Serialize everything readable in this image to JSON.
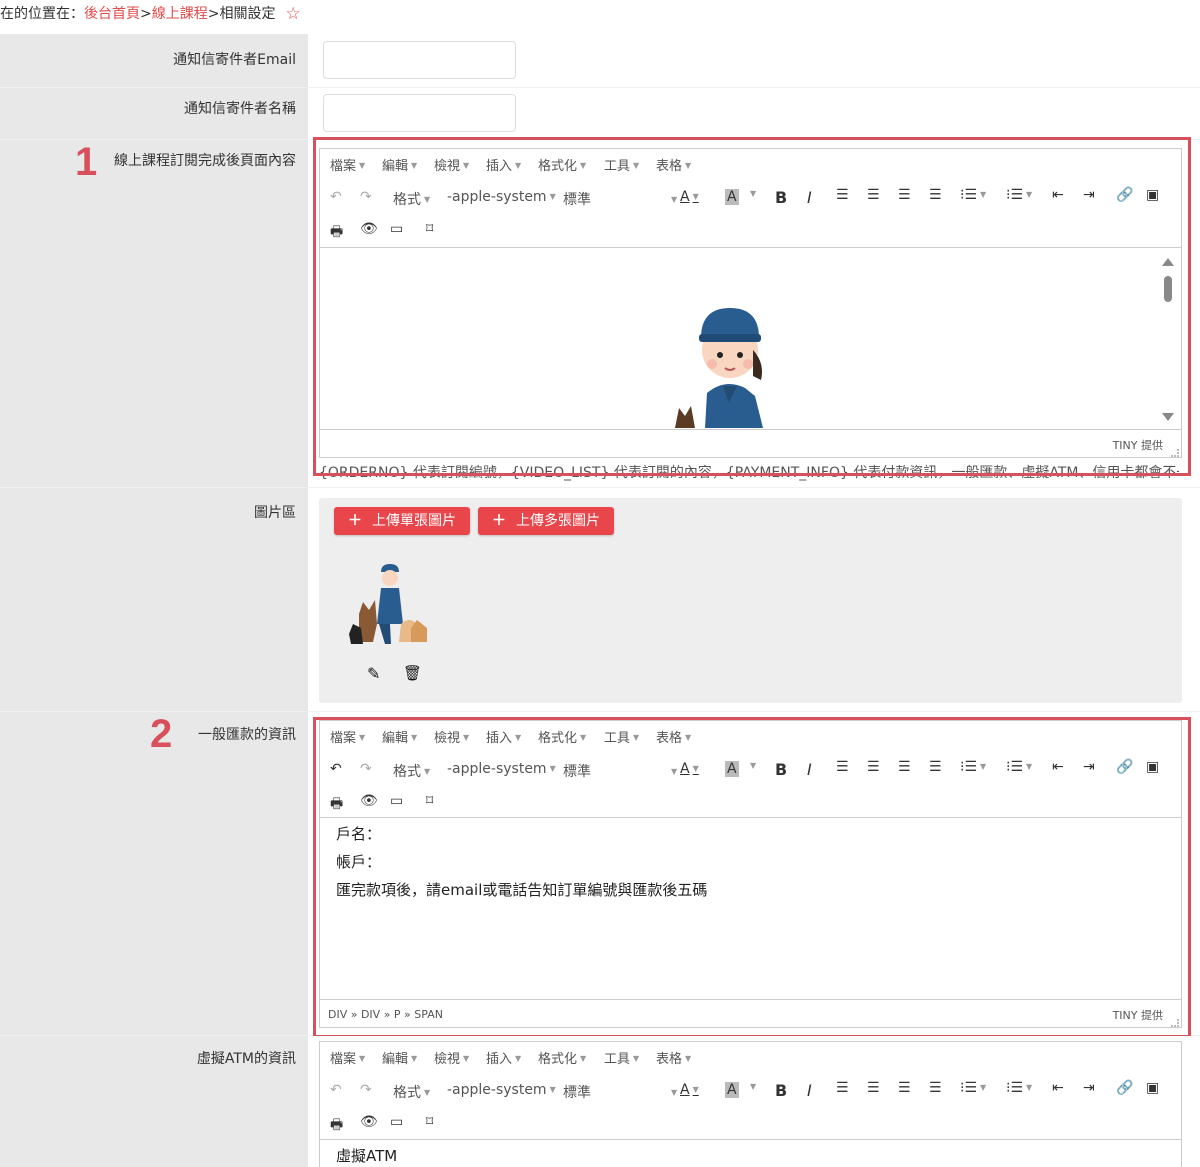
{
  "breadcrumb": {
    "prefix": "在的位置在：",
    "home": "後台首頁",
    "sep1": ">",
    "section": "線上課程",
    "sep2": ">",
    "current": "相關設定",
    "star": "☆"
  },
  "fields": {
    "sender_email_label": "通知信寄件者Email",
    "sender_email_value": "",
    "sender_name_label": "通知信寄件者名稱",
    "sender_name_value": "",
    "order_content_label": "線上課程訂閱完成後頁面內容",
    "image_area_label": "圖片區",
    "bank_info_label": "一般匯款的資訊",
    "atm_info_label": "虛擬ATM的資訊"
  },
  "annotations": {
    "one": "1",
    "two": "2"
  },
  "editor": {
    "menu": [
      "檔案",
      "編輯",
      "檢視",
      "插入",
      "格式化",
      "工具",
      "表格"
    ],
    "format_label": "格式",
    "font_family": "-apple-system",
    "font_size": "標準",
    "powered_by": "TINY 提供"
  },
  "notice_text": "{ORDERNO} 代表訂閱編號，{VIDEO_LIST} 代表訂閱的內容，{PAYMENT_INFO} 代表付款資訊，一般匯款、虛擬ATM、信用卡都會不一樣",
  "image_area": {
    "upload_single": "上傳單張圖片",
    "upload_multiple": "上傳多張圖片"
  },
  "bank_editor": {
    "lines": [
      "戶名：",
      "帳戶：",
      "匯完款項後，請email或電話告知訂單編號與匯款後五碼"
    ],
    "status_path": "DIV » DIV » P » SPAN"
  },
  "atm_editor": {
    "first_line": "虛擬ATM"
  },
  "colors": {
    "accent": "#d9505d",
    "link": "#e04a4a",
    "upload_button": "#e8464b",
    "label_bg": "#e8e8e8"
  }
}
